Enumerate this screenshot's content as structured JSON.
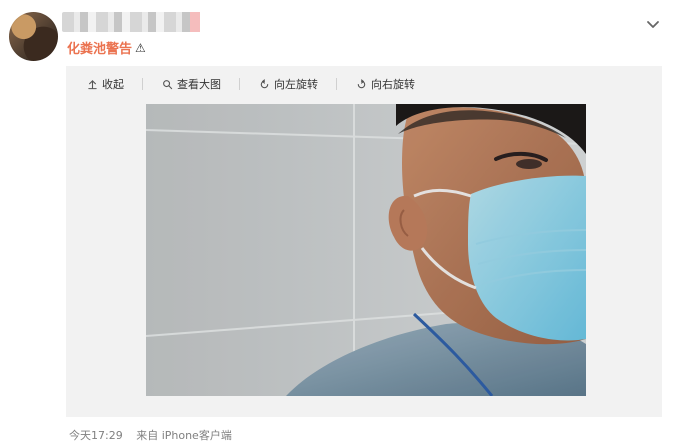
{
  "header": {
    "account_title": "化粪池警告",
    "warning_glyph": "⚠",
    "chevron_icon": "chevron-down-icon"
  },
  "toolbar": {
    "items": [
      {
        "label": "收起",
        "icon": "collapse-icon"
      },
      {
        "label": "查看大图",
        "icon": "search-icon"
      },
      {
        "label": "向左旋转",
        "icon": "rotate-left-icon"
      },
      {
        "label": "向右旋转",
        "icon": "rotate-right-icon"
      }
    ]
  },
  "footer": {
    "time": "今天17:29",
    "source": "来自 iPhone客户端"
  },
  "colors": {
    "accent": "#eb7350",
    "card_bg": "#f2f2f2",
    "meta_text": "#808080"
  }
}
